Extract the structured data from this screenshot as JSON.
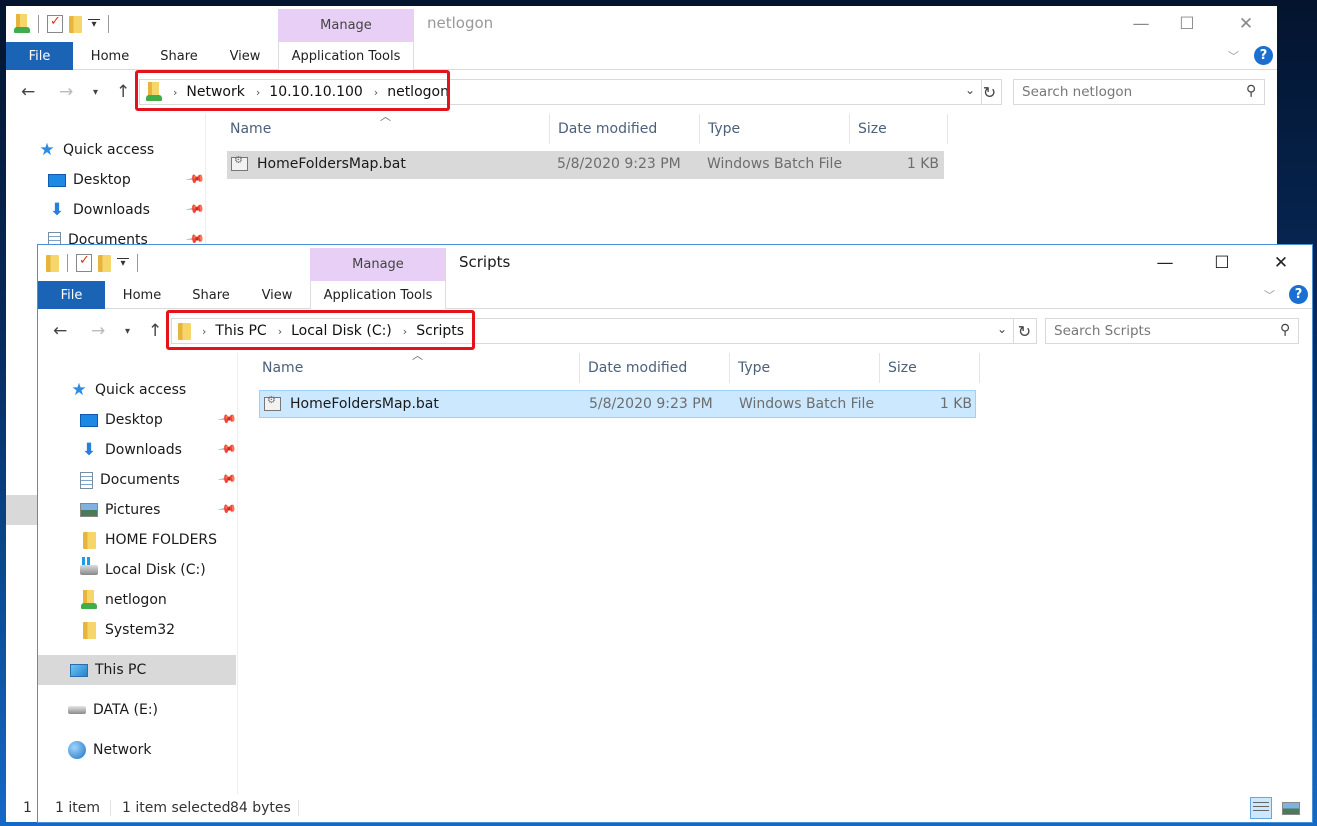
{
  "back_window": {
    "title": "netlogon",
    "contextual_tab_group": "Manage",
    "ribbon_tabs": [
      "File",
      "Home",
      "Share",
      "View",
      "Application Tools"
    ],
    "breadcrumb": [
      "Network",
      "10.10.10.100",
      "netlogon"
    ],
    "search_placeholder": "Search netlogon",
    "nav_items": [
      {
        "label": "Quick access",
        "icon": "quick-access-star-icon"
      },
      {
        "label": "Desktop",
        "icon": "desktop-icon",
        "pinned": true
      },
      {
        "label": "Downloads",
        "icon": "downloads-icon",
        "pinned": true
      },
      {
        "label": "Documents",
        "icon": "documents-icon",
        "pinned": true
      }
    ],
    "columns": [
      "Name",
      "Date modified",
      "Type",
      "Size"
    ],
    "files": [
      {
        "name": "HomeFoldersMap.bat",
        "date_modified": "5/8/2020 9:23 PM",
        "type": "Windows Batch File",
        "size": "1 KB"
      }
    ],
    "status_partial": "1 i"
  },
  "front_window": {
    "title": "Scripts",
    "contextual_tab_group": "Manage",
    "ribbon_tabs": [
      "File",
      "Home",
      "Share",
      "View",
      "Application Tools"
    ],
    "breadcrumb": [
      "This PC",
      "Local Disk (C:)",
      "Scripts"
    ],
    "search_placeholder": "Search Scripts",
    "nav_items": [
      {
        "label": "Quick access",
        "icon": "quick-access-star-icon"
      },
      {
        "label": "Desktop",
        "icon": "desktop-icon",
        "pinned": true
      },
      {
        "label": "Downloads",
        "icon": "downloads-icon",
        "pinned": true
      },
      {
        "label": "Documents",
        "icon": "documents-icon",
        "pinned": true
      },
      {
        "label": "Pictures",
        "icon": "pictures-icon",
        "pinned": true
      },
      {
        "label": "HOME FOLDERS",
        "icon": "folder-icon"
      },
      {
        "label": "Local Disk (C:)",
        "icon": "local-disk-icon"
      },
      {
        "label": "netlogon",
        "icon": "network-folder-icon"
      },
      {
        "label": "System32",
        "icon": "folder-icon"
      },
      {
        "label": "This PC",
        "icon": "this-pc-icon",
        "selected": true
      },
      {
        "label": "DATA (E:)",
        "icon": "drive-icon"
      },
      {
        "label": "Network",
        "icon": "network-icon"
      }
    ],
    "columns": [
      "Name",
      "Date modified",
      "Type",
      "Size"
    ],
    "files": [
      {
        "name": "HomeFoldersMap.bat",
        "date_modified": "5/8/2020 9:23 PM",
        "type": "Windows Batch File",
        "size": "1 KB",
        "selected": true
      }
    ],
    "status": {
      "item_count": "1 item",
      "selection": "1 item selected",
      "selection_size": "84 bytes"
    }
  },
  "colors": {
    "file_tab": "#1a63b5",
    "manage_tab": "#e8cff5",
    "highlight_box": "#e3121b",
    "selected_row": "#cce8ff",
    "inactive_selected_row": "#d9d9d9"
  }
}
